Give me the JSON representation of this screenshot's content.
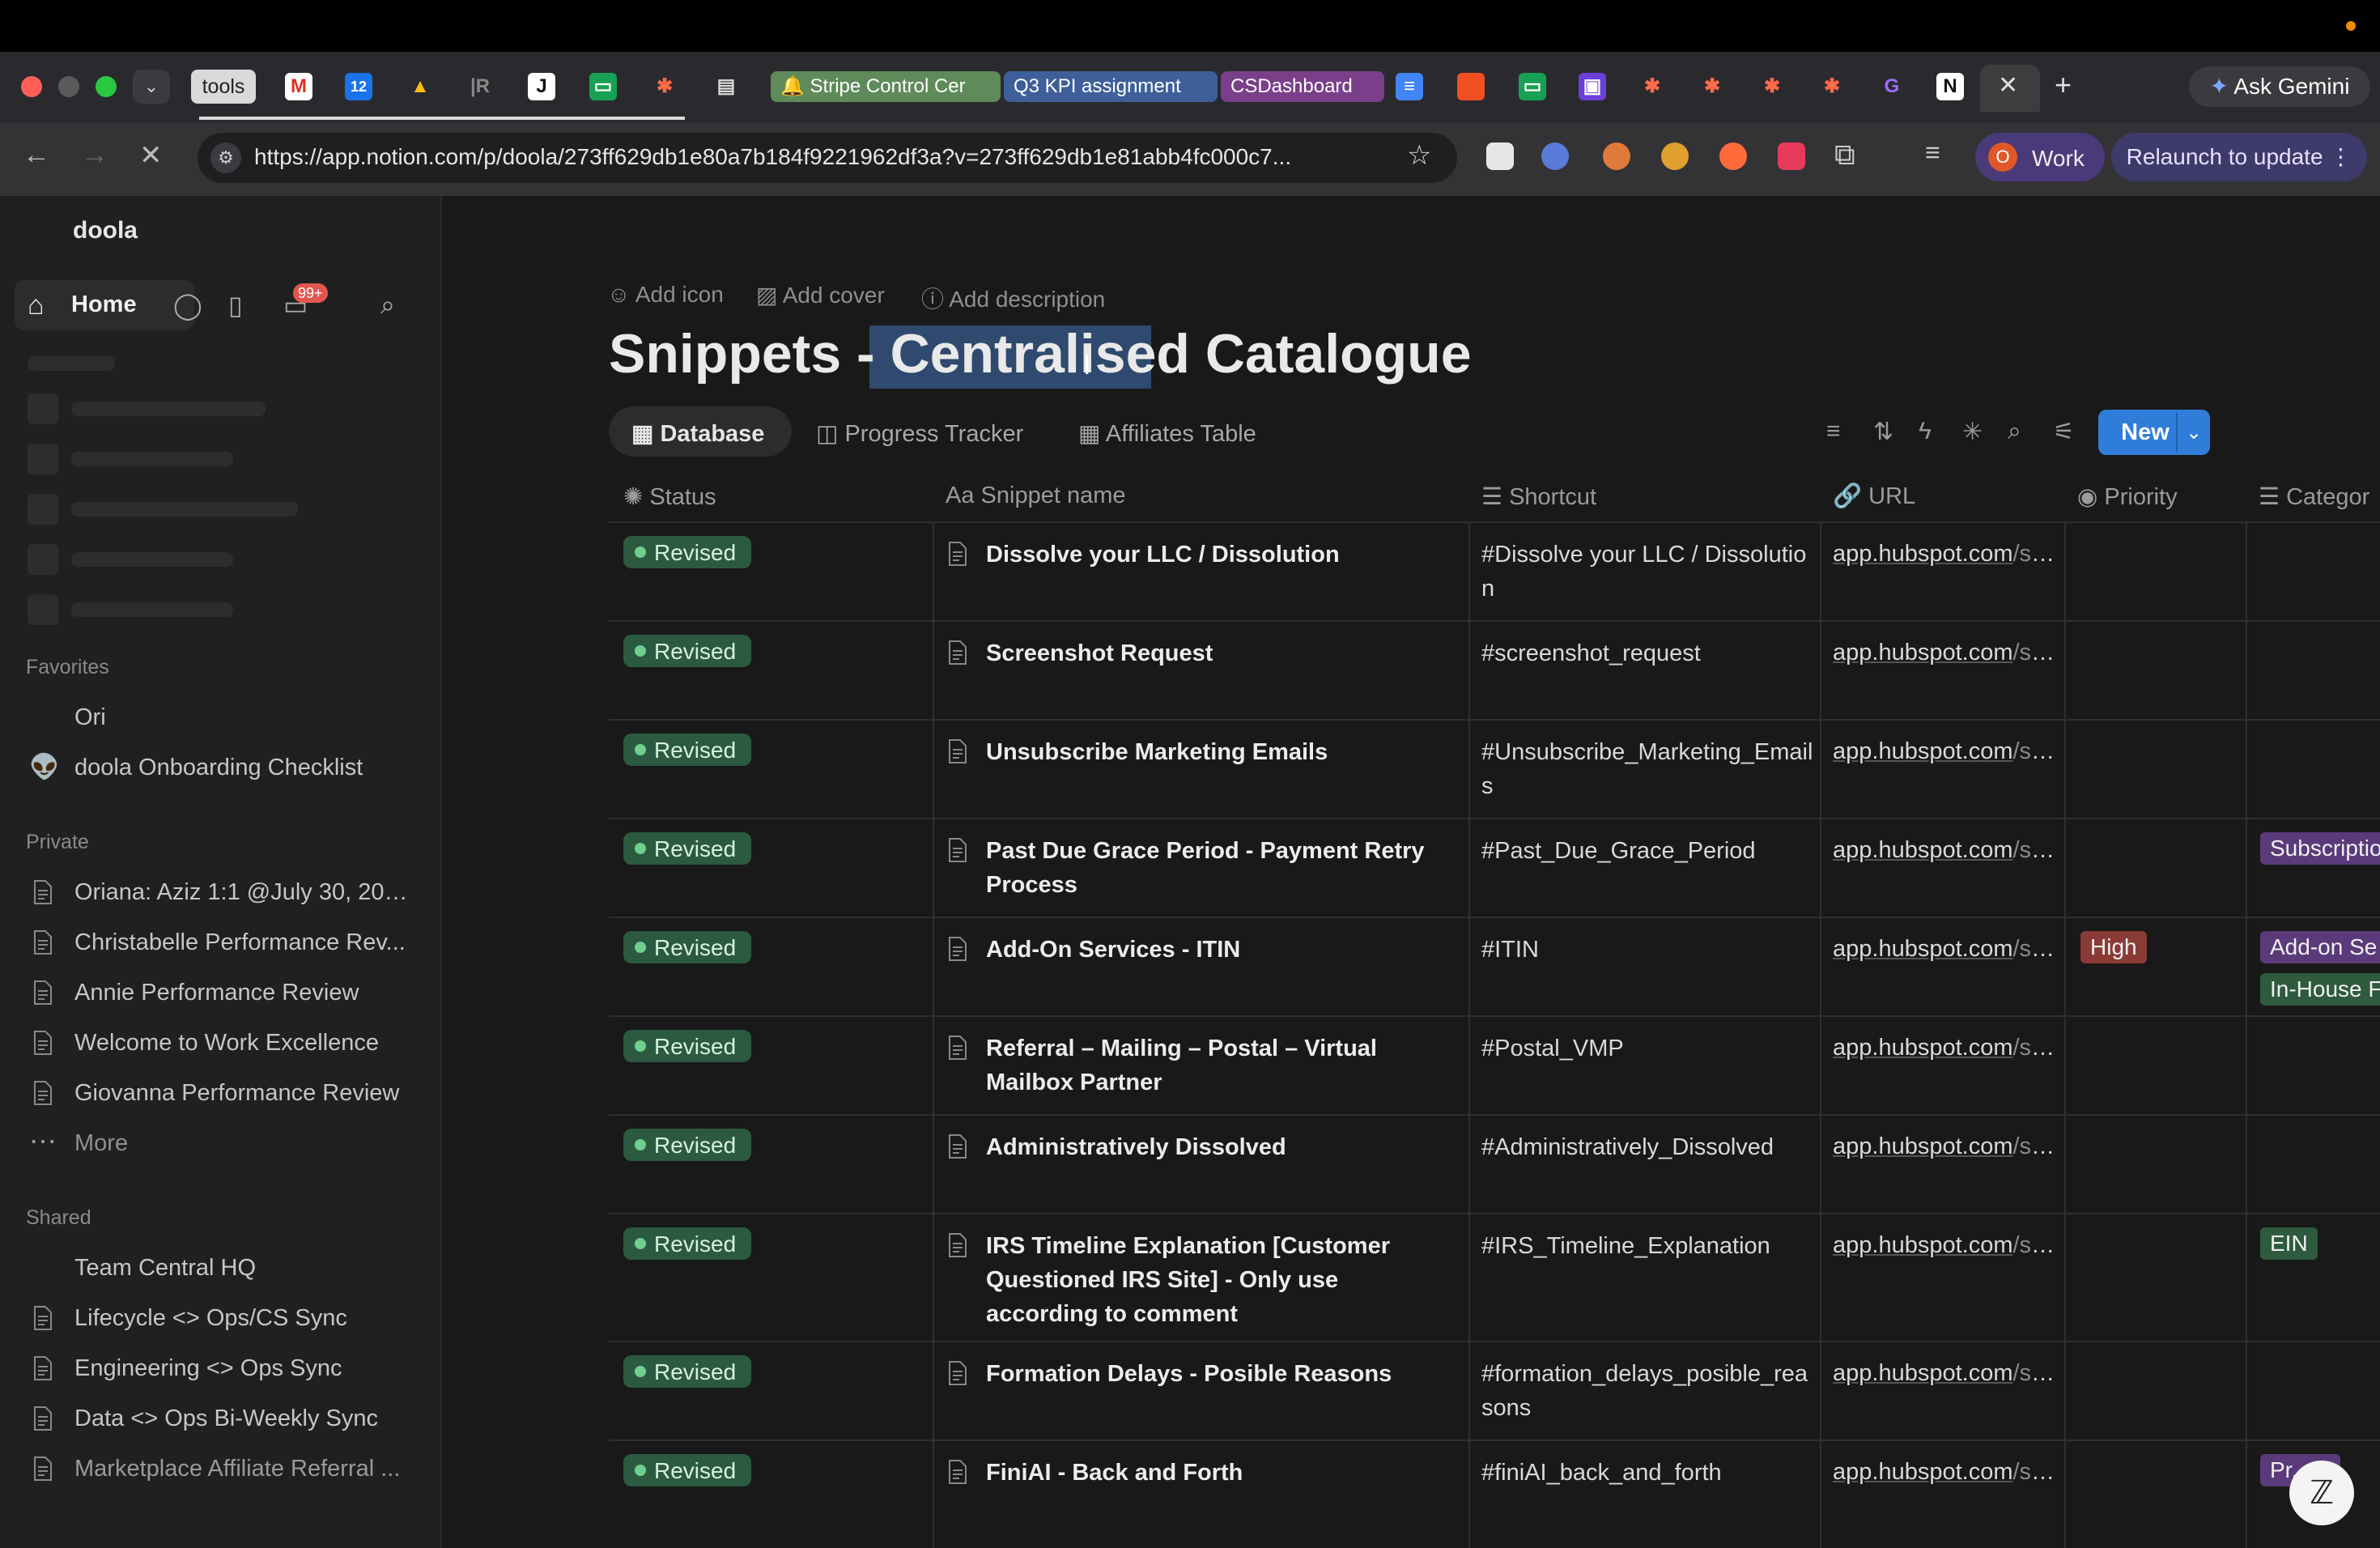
{
  "browser": {
    "tools_tab": "tools",
    "group_tabs": [
      {
        "label": "🔔 Stripe Control Cer",
        "bg": "#5f8a5a",
        "color": "#ffffff"
      },
      {
        "label": "Q3 KPI assignment",
        "bg": "#3f5f9a",
        "color": "#ffffff"
      },
      {
        "label": "CSDashboard",
        "bg": "#7a3f8a",
        "color": "#ffffff"
      }
    ],
    "url": "https://app.notion.com/p/doola/273ff629db1e80a7b184f9221962df3a?v=273ff629db1e81abb4fc000c7...",
    "profile_label": "Work",
    "profile_initial": "O",
    "relaunch_label": "Relaunch to update",
    "gemini_label": "Ask Gemini",
    "new_tab_label": "+"
  },
  "sidebar": {
    "workspace": "doola",
    "home_label": "Home",
    "inbox_badge": "99+",
    "favorites_title": "Favorites",
    "favorites": [
      "Ori",
      "doola Onboarding Checklist"
    ],
    "private_title": "Private",
    "private": [
      "Oriana: Aziz 1:1 @July 30, 202...",
      "Christabelle Performance Rev...",
      "Annie Performance Review",
      "Welcome to Work Excellence",
      "Giovanna Performance Review"
    ],
    "more_label": "More",
    "shared_title": "Shared",
    "shared": [
      "Team Central HQ",
      "Lifecycle <> Ops/CS Sync",
      "Engineering <> Ops Sync",
      "Data <> Ops Bi-Weekly Sync",
      "Marketplace Affiliate Referral ..."
    ]
  },
  "page": {
    "add_icon": "Add icon",
    "add_cover": "Add cover",
    "add_description": "Add description",
    "title_prefix": "Snippets - ",
    "title_highlight": "Centralised",
    "title_suffix": " Catalogue",
    "views": [
      "Database",
      "Progress Tracker",
      "Affiliates Table"
    ],
    "new_label": "New",
    "columns": [
      "Status",
      "Snippet name",
      "Shortcut",
      "URL",
      "Priority",
      "Categor"
    ],
    "rows": [
      {
        "status": "Revised",
        "name": "Dissolve your LLC / Dissolution",
        "shortcut": "#Dissolve your LLC / Dissolution",
        "url_host": "app.hubspot.com",
        "url_path": "/sni...",
        "priority": "",
        "categories": []
      },
      {
        "status": "Revised",
        "name": "Screenshot Request",
        "shortcut": "#screenshot_request",
        "url_host": "app.hubspot.com",
        "url_path": "/sni...",
        "priority": "",
        "categories": []
      },
      {
        "status": "Revised",
        "name": "Unsubscribe Marketing Emails",
        "shortcut": "#Unsubscribe_Marketing_Emails",
        "url_host": "app.hubspot.com",
        "url_path": "/sni...",
        "priority": "",
        "categories": []
      },
      {
        "status": "Revised",
        "name": "Past Due Grace Period - Payment Retry Process",
        "shortcut": "#Past_Due_Grace_Period",
        "url_host": "app.hubspot.com",
        "url_path": "/sni...",
        "priority": "",
        "categories": [
          "Subscriptio"
        ]
      },
      {
        "status": "Revised",
        "name": "Add-On Services - ITIN",
        "shortcut": "#ITIN",
        "url_host": "app.hubspot.com",
        "url_path": "/sni...",
        "priority": "High",
        "categories": [
          "Add-on Se",
          "In-House F"
        ]
      },
      {
        "status": "Revised",
        "name": "Referral – Mailing – Postal – Virtual Mailbox Partner",
        "shortcut": "#Postal_VMP",
        "url_host": "app.hubspot.com",
        "url_path": "/sni...",
        "priority": "",
        "categories": []
      },
      {
        "status": "Revised",
        "name": "Administratively Dissolved",
        "shortcut": "#Administratively_Dissolved",
        "url_host": "app.hubspot.com",
        "url_path": "/sni...",
        "priority": "",
        "categories": []
      },
      {
        "status": "Revised",
        "name": "IRS Timeline Explanation [Customer Questioned IRS Site] - Only use according to comment",
        "shortcut": "#IRS_Timeline_Explanation",
        "url_host": "app.hubspot.com",
        "url_path": "/sni...",
        "priority": "",
        "categories": [
          "EIN"
        ]
      },
      {
        "status": "Revised",
        "name": "Formation Delays - Posible Reasons",
        "shortcut": "#formation_delays_posible_reasons",
        "url_host": "app.hubspot.com",
        "url_path": "/sni...",
        "priority": "",
        "categories": []
      },
      {
        "status": "Revised",
        "name": "FiniAI - Back and Forth",
        "shortcut": "#finiAI_back_and_forth",
        "url_host": "app.hubspot.com",
        "url_path": "/sni...",
        "priority": "",
        "categories": [
          "Pr...re"
        ]
      }
    ]
  },
  "colors": {
    "status_bg": "#2b5a40",
    "priority_high_bg": "#8a3b36",
    "cat_purple_bg": "#5a3a7a",
    "cat_green_bg": "#2e5a3e",
    "accent_blue": "#2f7dd8"
  }
}
